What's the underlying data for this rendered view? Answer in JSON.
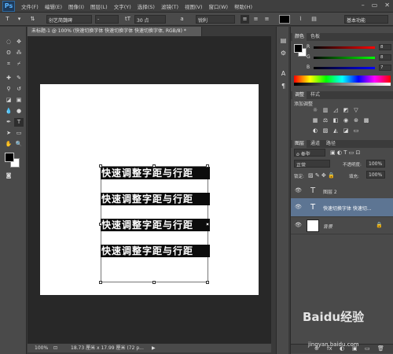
{
  "app": {
    "logo": "Ps"
  },
  "menu": [
    "文件(F)",
    "编辑(E)",
    "图像(I)",
    "图层(L)",
    "文字(Y)",
    "选择(S)",
    "滤镜(T)",
    "视图(V)",
    "窗口(W)",
    "帮助(H)"
  ],
  "window_buttons": [
    "–",
    "▭",
    "✕"
  ],
  "options": {
    "tool_icon": "T",
    "font_family": "创艺简魏碑",
    "font_style": "-",
    "size_icon": "tT",
    "font_size": "30 点",
    "aa_icon": "a",
    "aa": "锐利",
    "workspace": "基本功能"
  },
  "document": {
    "tab_title": "未标题-1 @ 100% (快速切换字体 快速切换字体 快速切换字体, RGB/8) *",
    "text_lines": [
      "快速调整字距与行距",
      "快速调整字距与行距",
      "快速调整字距与行距",
      "快速调整字距与行距"
    ]
  },
  "status": {
    "zoom": "100%",
    "doc_info": "18.73 厘米 x 17.99 厘米 (72 p...",
    "arrow": "▶"
  },
  "color_panel": {
    "tabs": [
      "颜色",
      "色板"
    ],
    "channels": [
      {
        "label": "R",
        "value": "8"
      },
      {
        "label": "G",
        "value": "8"
      },
      {
        "label": "B",
        "value": "7"
      }
    ]
  },
  "adjust_panel": {
    "tabs": [
      "调整",
      "样式"
    ],
    "header": "添加调整"
  },
  "layers_panel": {
    "tabs": [
      "图层",
      "通道",
      "路径"
    ],
    "kind": "ρ 类型",
    "blend_mode": "正常",
    "opacity_label": "不透明度:",
    "opacity": "100%",
    "lock_label": "锁定:",
    "fill_label": "填充:",
    "fill": "100%",
    "layers": [
      {
        "name": "图层 2",
        "thumb": "T"
      },
      {
        "name": "快速切换字体 快速切...",
        "thumb": "T"
      },
      {
        "name": "背景",
        "thumb": ""
      }
    ],
    "footer_icons": [
      "⊕",
      "fx",
      "◐",
      "▣",
      "▭",
      "🗑"
    ]
  },
  "watermark": {
    "brand": "Baidu经验",
    "url": "jingyan.baidu.com"
  },
  "colors": {
    "accent": "#5d7593",
    "fg": "#0c0c0c",
    "bg": "#ffffff"
  }
}
